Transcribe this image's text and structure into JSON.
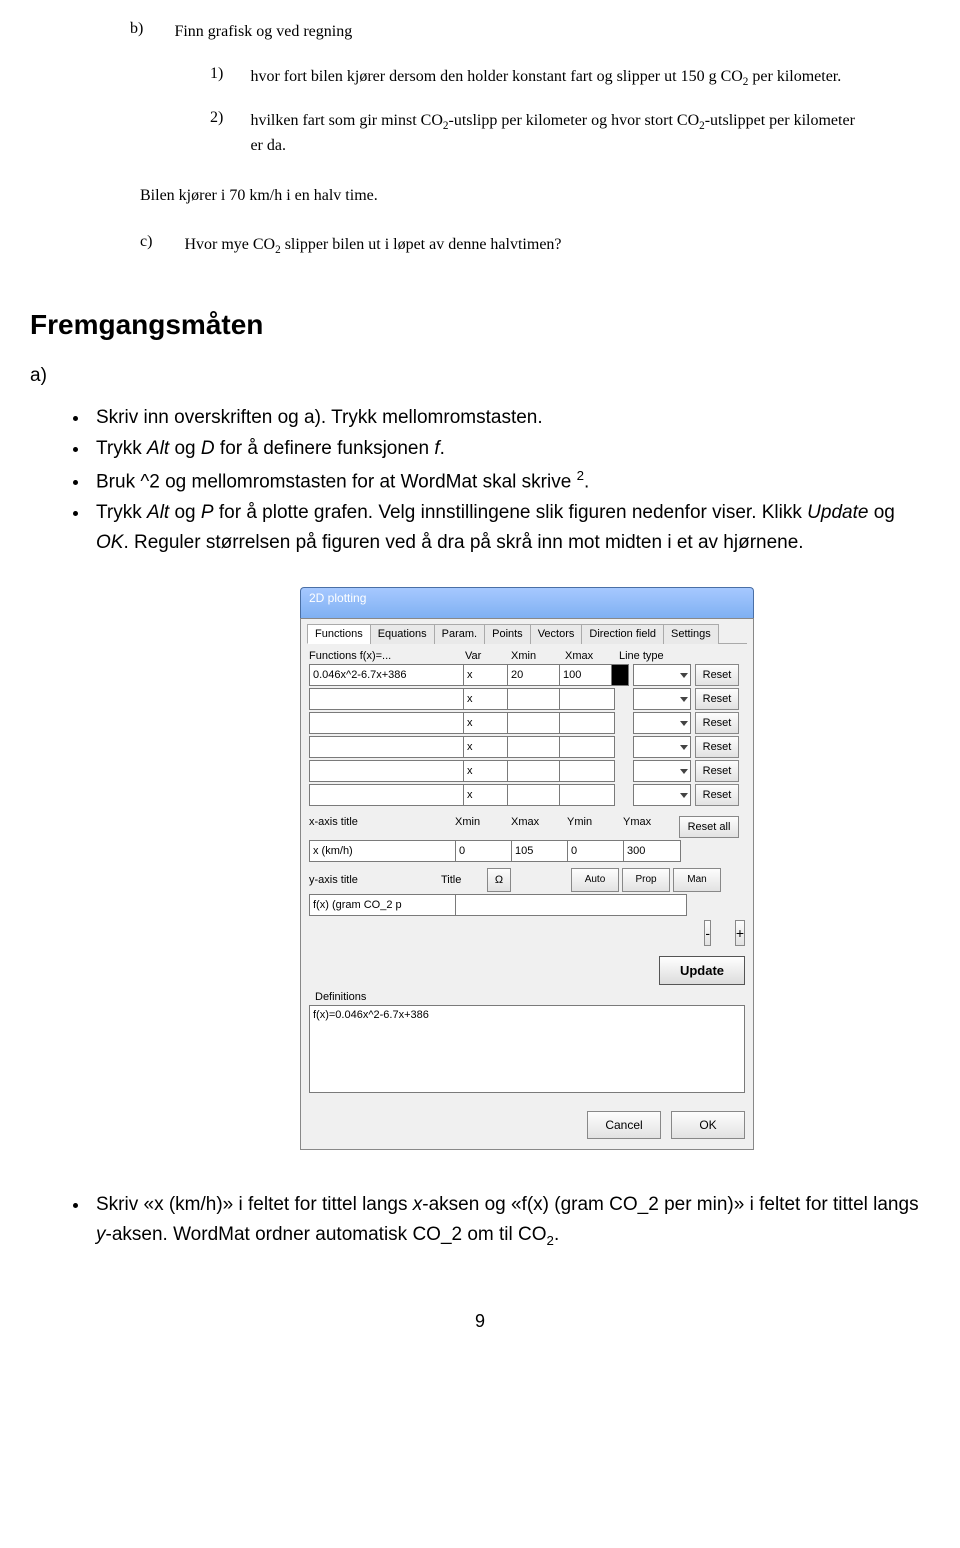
{
  "exercise": {
    "b_label": "b)",
    "b_text": "Finn grafisk og ved regning",
    "items": [
      {
        "num": "1)",
        "text_a": "hvor fort bilen kjører dersom den holder konstant fart og slipper ut 150 g  CO",
        "sub": "2",
        "text_b": " per kilometer."
      },
      {
        "num": "2)",
        "text_a": "hvilken fart som gir minst CO",
        "sub1": "2",
        "text_b": "-utslipp per kilometer og hvor stort CO",
        "sub2": "2",
        "text_c": "-utslippet per kilometer er da."
      }
    ],
    "mid": "Bilen kjører i 70 km/h i en halv time.",
    "c_label": "c)",
    "c_text_a": "Hvor mye CO",
    "c_sub": "2",
    "c_text_b": " slipper bilen ut i løpet av denne halvtimen?"
  },
  "heading": "Fremgangsmåten",
  "a_label": "a)",
  "bullets": {
    "b1": "Skriv inn overskriften og a). Trykk mellomromstasten.",
    "b2_a": "Trykk ",
    "b2_i": "Alt",
    "b2_b": " og ",
    "b2_i2": "D",
    "b2_c": " for å definere funksjonen ",
    "b2_i3": "f",
    "b2_d": ".",
    "b3_a": "Bruk ^2 og mellomromstasten for at WordMat skal skrive ",
    "b3_sup": "2",
    "b3_b": ".",
    "b4_a": "Trykk ",
    "b4_i": "Alt",
    "b4_b": " og ",
    "b4_i2": "P",
    "b4_c": " for å plotte grafen. Velg innstillingene slik figuren nedenfor viser. Klikk ",
    "b4_i3": "Update",
    "b4_d": " og ",
    "b4_i4": "OK",
    "b4_e": ". Reguler størrelsen på figuren ved å dra på skrå inn mot midten i et av hjørnene."
  },
  "dialog": {
    "title": "2D plotting",
    "tabs": [
      "Functions",
      "Equations",
      "Param.",
      "Points",
      "Vectors",
      "Direction field",
      "Settings"
    ],
    "collabels": {
      "func": "Functions  f(x)=...",
      "var": "Var",
      "xmin": "Xmin",
      "xmax": "Xmax",
      "lt": "Line type"
    },
    "rows": [
      {
        "fx": "0.046x^2-6.7x+386",
        "var": "x",
        "xmin": "20",
        "xmax": "100",
        "reset": "Reset"
      },
      {
        "fx": "",
        "var": "x",
        "xmin": "",
        "xmax": "",
        "reset": "Reset"
      },
      {
        "fx": "",
        "var": "x",
        "xmin": "",
        "xmax": "",
        "reset": "Reset"
      },
      {
        "fx": "",
        "var": "x",
        "xmin": "",
        "xmax": "",
        "reset": "Reset"
      },
      {
        "fx": "",
        "var": "x",
        "xmin": "",
        "xmax": "",
        "reset": "Reset"
      },
      {
        "fx": "",
        "var": "x",
        "xmin": "",
        "xmax": "",
        "reset": "Reset"
      }
    ],
    "axis": {
      "xaxis_label": "x-axis title",
      "xmin_l": "Xmin",
      "xmax_l": "Xmax",
      "ymin_l": "Ymin",
      "ymax_l": "Ymax",
      "resetall": "Reset all",
      "xtitle": "x (km/h)",
      "xmin": "0",
      "xmax": "105",
      "ymin": "0",
      "ymax": "300",
      "yaxis_label": "y-axis title",
      "title_l": "Title",
      "omega": "Ω",
      "ytitle": "f(x) (gram CO_2 p",
      "auto": "Auto",
      "prop": "Prop",
      "man": "Man",
      "minus": "-",
      "plus": "+"
    },
    "update": "Update",
    "def_label": "Definitions",
    "def_text": "f(x)=0.046x^2-6.7x+386",
    "cancel": "Cancel",
    "ok": "OK"
  },
  "bottom": {
    "text_a": "Skriv «x (km/h)» i feltet for tittel langs ",
    "i1": "x",
    "text_b": "-aksen og «f(x) (gram CO_2 per min)» i feltet for tittel langs ",
    "i2": "y",
    "text_c": "-aksen. WordMat ordner automatisk CO_2 om til CO",
    "sub": "2",
    "text_d": "."
  },
  "pagenum": "9"
}
